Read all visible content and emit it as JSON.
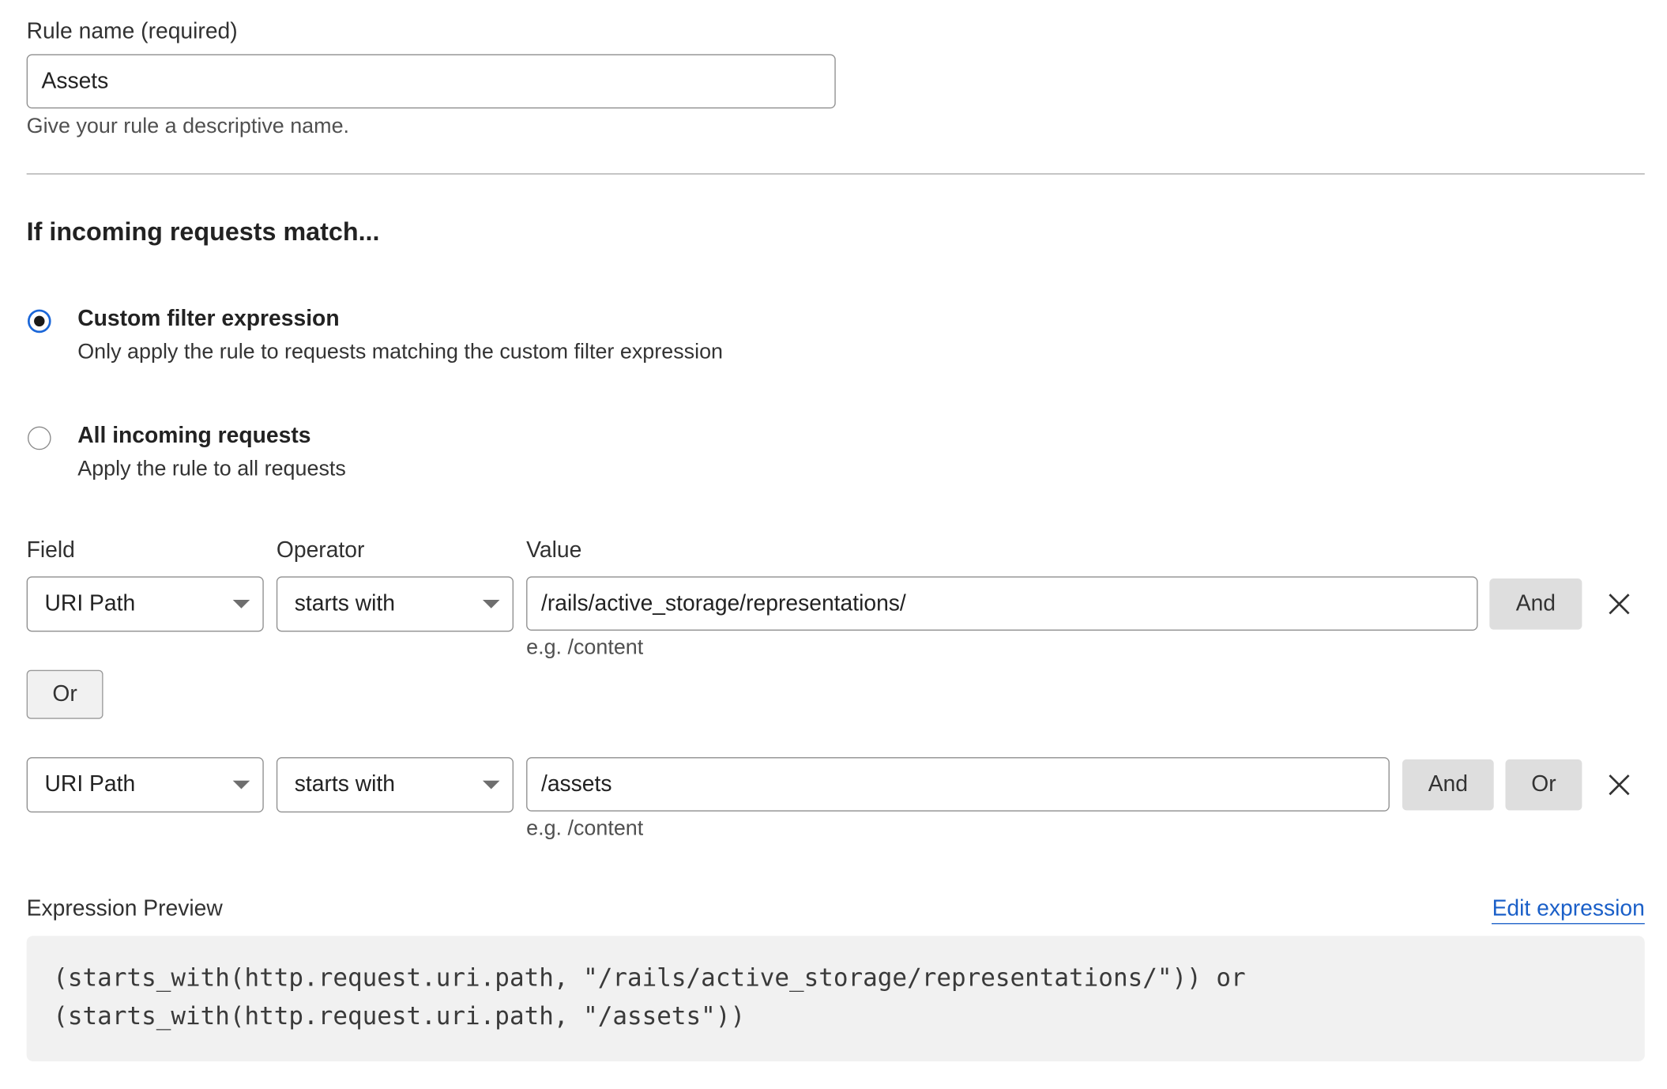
{
  "rule_name": {
    "label": "Rule name (required)",
    "value": "Assets",
    "help": "Give your rule a descriptive name."
  },
  "match_section": {
    "title": "If incoming requests match...",
    "options": [
      {
        "title": "Custom filter expression",
        "description": "Only apply the rule to requests matching the custom filter expression",
        "selected": true
      },
      {
        "title": "All incoming requests",
        "description": "Apply the rule to all requests",
        "selected": false
      }
    ]
  },
  "filter": {
    "columns": {
      "field": "Field",
      "operator": "Operator",
      "value": "Value"
    },
    "or_button": "Or",
    "conditions": [
      {
        "field": "URI Path",
        "operator": "starts with",
        "value": "/rails/active_storage/representations/",
        "hint": "e.g. /content",
        "and_label": "And"
      },
      {
        "field": "URI Path",
        "operator": "starts with",
        "value": "/assets",
        "hint": "e.g. /content",
        "and_label": "And",
        "or_label": "Or"
      }
    ]
  },
  "expression_preview": {
    "label": "Expression Preview",
    "edit_link": "Edit expression",
    "lines": [
      "(starts_with(http.request.uri.path, \"/rails/active_storage/representations/\")) or",
      "(starts_with(http.request.uri.path, \"/assets\"))"
    ]
  },
  "colors": {
    "radio_selected": "#1a66d8",
    "link": "#1a5fc8",
    "button_gray": "#dedede",
    "preview_bg": "#f1f1f1"
  }
}
